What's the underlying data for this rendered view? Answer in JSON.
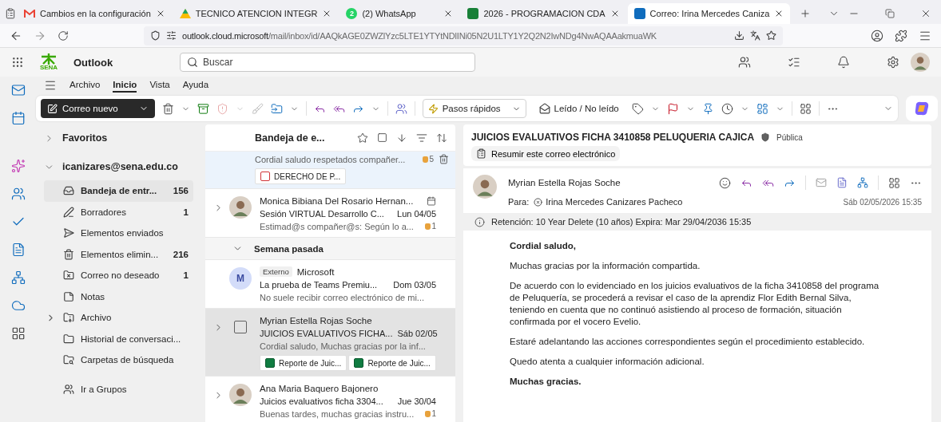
{
  "browser": {
    "tabs": [
      {
        "title": "Cambios en la configuración",
        "kind": "gmail",
        "selected": false
      },
      {
        "title": "TECNICO ATENCION INTEGR",
        "kind": "drive",
        "selected": false
      },
      {
        "title": "(2) WhatsApp",
        "kind": "whatsapp",
        "badge": "2",
        "selected": false
      },
      {
        "title": "2026 - PROGRAMACION CDA",
        "kind": "sheets",
        "selected": false
      },
      {
        "title": "Correo: Irina Mercedes Caniza",
        "kind": "outlook",
        "selected": true
      }
    ],
    "address": {
      "host": "outlook.cloud.microsoft",
      "path": "/mail/inbox/id/AAQkAGE0ZWZlYzc5LTE1YTYtNDlINi05N2U1LTY1Y2Q2N2IwNDg4NwAQAAakmuaWK"
    }
  },
  "app": {
    "logo": "SENA",
    "name": "Outlook",
    "search": {
      "placeholder": "Buscar"
    }
  },
  "ribbon": {
    "tabs": [
      {
        "label": "Archivo",
        "selected": false
      },
      {
        "label": "Inicio",
        "selected": true
      },
      {
        "label": "Vista",
        "selected": false
      },
      {
        "label": "Ayuda",
        "selected": false
      }
    ],
    "new_mail": "Correo nuevo",
    "quick_steps": "Pasos rápidos",
    "read_unread": "Leído / No leído"
  },
  "folders": {
    "favorites": {
      "label": "Favoritos",
      "expanded": false
    },
    "account": {
      "label": "icanizares@sena.edu.co",
      "expanded": true
    },
    "items": [
      {
        "kind": "inbox",
        "label": "Bandeja de entr...",
        "count": "156",
        "selected": true
      },
      {
        "kind": "drafts",
        "label": "Borradores",
        "count": "1",
        "selected": false
      },
      {
        "kind": "sent",
        "label": "Elementos enviados",
        "selected": false
      },
      {
        "kind": "deleted",
        "label": "Elementos elimin...",
        "count": "216",
        "selected": false
      },
      {
        "kind": "junk",
        "label": "Correo no deseado",
        "count": "1",
        "selected": false
      },
      {
        "kind": "notes",
        "label": "Notas",
        "selected": false
      },
      {
        "kind": "archive",
        "label": "Archivo",
        "selected": false
      },
      {
        "kind": "history",
        "label": "Historial de conversaci...",
        "selected": false
      },
      {
        "kind": "search",
        "label": "Carpetas de búsqueda",
        "selected": false
      }
    ],
    "groups": "Ir a Grupos"
  },
  "mail_list": {
    "title": "Bandeja de e...",
    "items": [
      {
        "kind": "partial",
        "preview": "Cordial saludo respetados compañer...",
        "likes": "5",
        "attachments": [
          {
            "kind": "pdf",
            "name": "DERECHO DE P..."
          }
        ],
        "selected": true,
        "hovered": false
      },
      {
        "kind": "message",
        "thread": true,
        "avatar": {
          "kind": "photo"
        },
        "sender": "Monica Bibiana Del Rosario Hernan...",
        "subject": "Sesión VIRTUAL Desarrollo C...",
        "date": "Lun 04/05",
        "preview": "Estimad@s compañer@s: Según lo a...",
        "likes": "1",
        "selected": false,
        "hovered": false
      },
      {
        "kind": "group",
        "label": "Semana pasada",
        "expanded": true
      },
      {
        "kind": "message",
        "thread": false,
        "avatar": {
          "kind": "initial",
          "text": "M"
        },
        "tag": "Externo",
        "sender": "Microsoft",
        "subject": "La prueba de Teams Premiu...",
        "date": "Dom 03/05",
        "preview": "No suele recibir correo electrónico de mi...",
        "selected": false,
        "hovered": false
      },
      {
        "kind": "message",
        "thread": true,
        "avatar": {
          "kind": "checkbox",
          "checked": false
        },
        "sender": "Myrian Estella Rojas Soche",
        "subject": "JUICIOS EVALUATIVOS FICHA...",
        "date": "Sáb 02/05",
        "preview": "Cordial saludo, Muchas gracias por la inf...",
        "attachments": [
          {
            "kind": "excel",
            "name": "Reporte de Juic..."
          },
          {
            "kind": "excel",
            "name": "Reporte de Juic..."
          }
        ],
        "selected": false,
        "hovered": true
      },
      {
        "kind": "message",
        "thread": true,
        "avatar": {
          "kind": "photo"
        },
        "sender": "Ana Maria Baquero Bajonero",
        "subject": "Juicios evaluativos ficha 3304...",
        "date": "Jue 30/04",
        "preview": "Buenas tardes, muchas gracias instru...",
        "likes": "1",
        "selected": false,
        "hovered": false
      }
    ]
  },
  "reading": {
    "subject": "JUICIOS EVALUATIVOS FICHA 3410858 PELUQUERIA CAJICA",
    "sensitivity": "Pública",
    "summarize": "Resumir este correo electrónico",
    "sender": "Myrian Estella Rojas Soche",
    "to_label": "Para:",
    "to": "Irina Mercedes Canizares Pacheco",
    "date": "Sáb 02/05/2026 15:35",
    "retention": "Retención: 10 Year Delete (10 años) Expira: Mar 29/04/2036 15:35",
    "body": [
      {
        "kind": "bold",
        "text": "Cordial saludo,"
      },
      {
        "kind": "text",
        "text": "Muchas gracias por la información compartida."
      },
      {
        "kind": "text",
        "text": "De acuerdo con lo evidenciado en los juicios evaluativos de la ficha 3410858 del programa de Peluquería, se procederá a revisar el caso de la aprendiz Flor Edith Bernal Silva, teniendo en cuenta que no continuó asistiendo al proceso de formación, situación confirmada por el vocero Evelio."
      },
      {
        "kind": "text",
        "text": "Estaré adelantando las acciones correspondientes según el procedimiento establecido."
      },
      {
        "kind": "text",
        "text": "Quedo atenta a cualquier información adicional."
      },
      {
        "kind": "bold",
        "text": "Muchas gracias."
      }
    ]
  }
}
